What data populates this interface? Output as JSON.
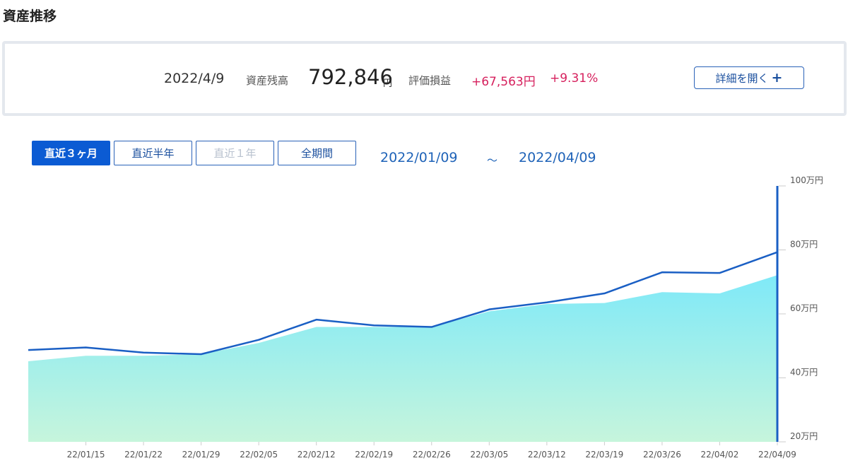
{
  "page": {
    "title": "資産推移"
  },
  "summary": {
    "date": "2022/4/9",
    "balance_label": "資産残高",
    "balance_value": "792,846",
    "balance_unit": "円",
    "pl_label": "評価損益",
    "pl_value": "+67,563円",
    "pl_percent": "+9.31%",
    "detail_button": "詳細を開く",
    "detail_button_icon": "+",
    "colors": {
      "profit": "#d6205d",
      "accent": "#0b5bd3"
    }
  },
  "period_tabs": [
    {
      "label": "直近３ヶ月",
      "state": "active"
    },
    {
      "label": "直近半年",
      "state": "normal"
    },
    {
      "label": "直近１年",
      "state": "disabled"
    },
    {
      "label": "全期間",
      "state": "normal"
    }
  ],
  "date_range": {
    "start": "2022/01/09",
    "separator": "～",
    "end": "2022/04/09"
  },
  "chart_data": {
    "type": "area",
    "title": "",
    "xlabel": "",
    "ylabel": "",
    "x": [
      "22/01/09",
      "22/01/15",
      "22/01/22",
      "22/01/29",
      "22/02/05",
      "22/02/12",
      "22/02/19",
      "22/02/26",
      "22/03/05",
      "22/03/12",
      "22/03/19",
      "22/03/26",
      "22/04/02",
      "22/04/09"
    ],
    "x_tick_labels": [
      "22/01/15",
      "22/01/22",
      "22/01/29",
      "22/02/05",
      "22/02/12",
      "22/02/19",
      "22/02/26",
      "22/03/05",
      "22/03/12",
      "22/03/19",
      "22/03/26",
      "22/04/02",
      "22/04/09"
    ],
    "y_tick_labels": [
      "100万円",
      "80万円",
      "60万円",
      "40万円",
      "20万円"
    ],
    "y_ticks": [
      100,
      80,
      60,
      40,
      20
    ],
    "ylim": [
      20,
      100
    ],
    "y_unit": "万円",
    "series": [
      {
        "kind": "line",
        "color": "#1a5fc4",
        "values": [
          48.7,
          49.5,
          47.9,
          47.4,
          51.9,
          58.2,
          56.4,
          55.9,
          61.4,
          63.6,
          66.4,
          73.0,
          72.8,
          79.3
        ]
      },
      {
        "kind": "area",
        "color_top": "#7fe9f8",
        "color_bottom": "#c6f5dc",
        "values": [
          45.2,
          46.9,
          46.9,
          47.4,
          50.9,
          55.9,
          55.9,
          55.9,
          60.8,
          63.1,
          63.4,
          66.8,
          66.4,
          72.1
        ]
      }
    ],
    "grid": false,
    "marker_at_last": true
  }
}
